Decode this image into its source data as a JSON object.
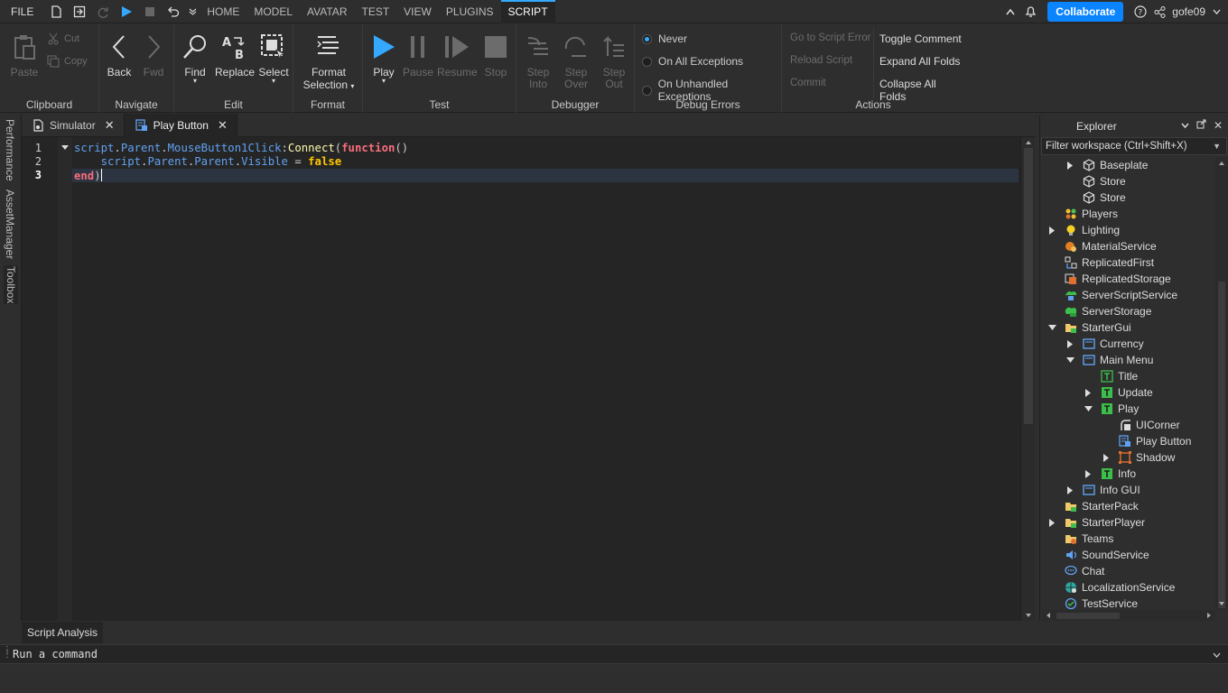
{
  "topbar": {
    "file": "FILE",
    "tabs": [
      "HOME",
      "MODEL",
      "AVATAR",
      "TEST",
      "VIEW",
      "PLUGINS",
      "SCRIPT"
    ],
    "active_tab": "SCRIPT",
    "collaborate": "Collaborate",
    "username": "gofe09"
  },
  "ribbon": {
    "clipboard": {
      "label": "Clipboard",
      "paste": "Paste",
      "cut": "Cut",
      "copy": "Copy"
    },
    "navigate": {
      "label": "Navigate",
      "back": "Back",
      "fwd": "Fwd"
    },
    "edit": {
      "label": "Edit",
      "find": "Find",
      "replace": "Replace",
      "select": "Select"
    },
    "format": {
      "label": "Format",
      "format_selection_1": "Format",
      "format_selection_2": "Selection"
    },
    "test": {
      "label": "Test",
      "play": "Play",
      "pause": "Pause",
      "resume": "Resume",
      "stop": "Stop"
    },
    "debugger": {
      "label": "Debugger",
      "step_into_1": "Step",
      "step_into_2": "Into",
      "step_over_1": "Step",
      "step_over_2": "Over",
      "step_out_1": "Step",
      "step_out_2": "Out"
    },
    "debug_errors": {
      "label": "Debug Errors",
      "never": "Never",
      "all": "On All Exceptions",
      "unhandled": "On Unhandled Exceptions",
      "selected": "Never"
    },
    "actions": {
      "label": "Actions",
      "go_to_error": "Go to Script Error",
      "reload": "Reload Script",
      "commit": "Commit",
      "toggle_comment": "Toggle Comment",
      "expand": "Expand All Folds",
      "collapse": "Collapse All Folds"
    }
  },
  "left_rail": [
    "Performance",
    "AssetManager",
    "Toolbox"
  ],
  "doc_tabs": [
    {
      "label": "Simulator",
      "active": false
    },
    {
      "label": "Play Button",
      "active": true
    }
  ],
  "editor": {
    "line_numbers": [
      "1",
      "2",
      "3"
    ],
    "current_line": "3",
    "code": {
      "l1": {
        "a": "script",
        "b": ".",
        "c": "Parent",
        "d": ".",
        "e": "MouseButton1Click",
        ":": ":",
        "f": "Connect",
        "g": "(",
        "h": "function",
        "i": "()"
      },
      "l2": {
        "indent": "    ",
        "a": "script",
        "b": ".",
        "c": "Parent",
        "d": ".",
        "e": "Parent",
        "f": ".",
        "g": "Visible",
        "h": " = ",
        "i": "false"
      },
      "l3": {
        "a": "end",
        "b": ")"
      }
    }
  },
  "explorer": {
    "title": "Explorer",
    "filter_placeholder": "Filter workspace (Ctrl+Shift+X)",
    "items": [
      {
        "label": "Baseplate",
        "icon": "part-icon",
        "arrow": "collapsed"
      },
      {
        "label": "Store",
        "icon": "part-icon",
        "arrow": ""
      },
      {
        "label": "Store",
        "icon": "part-icon",
        "arrow": ""
      },
      {
        "label": "Players",
        "icon": "players-icon",
        "arrow": ""
      },
      {
        "label": "Lighting",
        "icon": "lighting-icon",
        "arrow": "collapsed"
      },
      {
        "label": "MaterialService",
        "icon": "material-service-icon",
        "arrow": ""
      },
      {
        "label": "ReplicatedFirst",
        "icon": "replicated-first-icon",
        "arrow": ""
      },
      {
        "label": "ReplicatedStorage",
        "icon": "replicated-storage-icon",
        "arrow": ""
      },
      {
        "label": "ServerScriptService",
        "icon": "server-script-service-icon",
        "arrow": ""
      },
      {
        "label": "ServerStorage",
        "icon": "server-storage-icon",
        "arrow": ""
      },
      {
        "label": "StarterGui",
        "icon": "folder-icon",
        "arrow": "expanded"
      },
      {
        "label": "Currency",
        "icon": "screen-gui-icon",
        "arrow": "collapsed"
      },
      {
        "label": "Main Menu",
        "icon": "screen-gui-icon",
        "arrow": "expanded"
      },
      {
        "label": "Title",
        "icon": "text-label-icon",
        "arrow": ""
      },
      {
        "label": "Update",
        "icon": "text-button-icon",
        "arrow": "collapsed"
      },
      {
        "label": "Play",
        "icon": "text-button-icon",
        "arrow": "expanded"
      },
      {
        "label": "UICorner",
        "icon": "ui-corner-icon",
        "arrow": ""
      },
      {
        "label": "Play Button",
        "icon": "local-script-icon",
        "arrow": ""
      },
      {
        "label": "Shadow",
        "icon": "frame-icon",
        "arrow": "collapsed"
      },
      {
        "label": "Info",
        "icon": "text-button-icon",
        "arrow": "collapsed"
      },
      {
        "label": "Info GUI",
        "icon": "screen-gui-icon",
        "arrow": "collapsed"
      },
      {
        "label": "StarterPack",
        "icon": "folder-icon",
        "arrow": ""
      },
      {
        "label": "StarterPlayer",
        "icon": "folder-icon",
        "arrow": "collapsed"
      },
      {
        "label": "Teams",
        "icon": "teams-icon",
        "arrow": ""
      },
      {
        "label": "SoundService",
        "icon": "sound-icon",
        "arrow": ""
      },
      {
        "label": "Chat",
        "icon": "chat-icon",
        "arrow": ""
      },
      {
        "label": "LocalizationService",
        "icon": "localization-icon",
        "arrow": ""
      },
      {
        "label": "TestService",
        "icon": "test-service-icon",
        "arrow": ""
      }
    ]
  },
  "bottom": {
    "script_analysis": "Script Analysis",
    "command_placeholder": "Run a command"
  },
  "colors": {
    "accent": "#35a8ff",
    "collaborate": "#0a84ff",
    "keyword": "#f86d7c",
    "boolean": "#ffc600",
    "property": "#61a1f1",
    "method": "#fdfbac"
  }
}
